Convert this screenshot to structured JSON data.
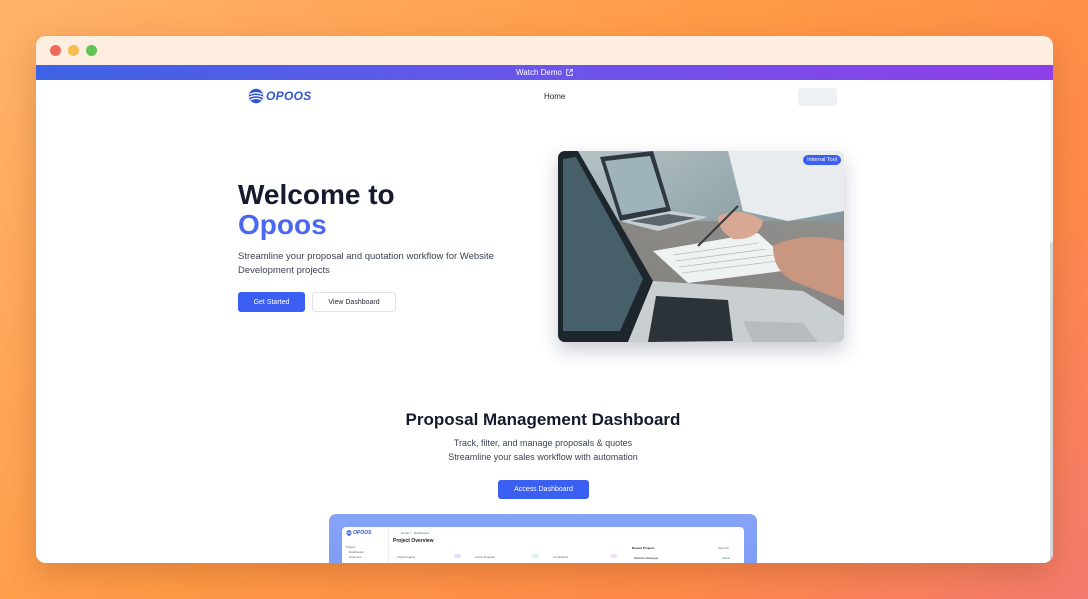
{
  "banner": {
    "text": "Watch Demo",
    "icon": "external-link-icon"
  },
  "nav": {
    "logo": "OPOOS",
    "home": "Home"
  },
  "hero": {
    "title_line1": "Welcome to",
    "title_line2": "Opoos",
    "subtitle": "Streamline your proposal and quotation workflow for Website Development projects",
    "primary_button": "Get Started",
    "secondary_button": "View Dashboard",
    "image_badge": "Internal Tool"
  },
  "dashboard_section": {
    "title": "Proposal Management Dashboard",
    "subtitle_line1": "Track, filter, and manage proposals & quotes",
    "subtitle_line2": "Streamline your sales workflow with automation",
    "button": "Access Dashboard"
  },
  "preview": {
    "logo": "OPOOS",
    "breadcrumb_home": "Home",
    "breadcrumb_sep": "/",
    "breadcrumb_page": "Dashboard",
    "title": "Project Overview",
    "sidebar_label": "Project",
    "sidebar_items": [
      "Dashboard",
      "Overview"
    ],
    "stats": [
      "Total Projects",
      "Active Projects",
      "Completed"
    ],
    "recent_title": "Recent Projects",
    "recent_action": "View All",
    "recent_row": "Website Redesign",
    "recent_status": "Active"
  },
  "colors": {
    "accent": "#3b5ff3",
    "banner_start": "#3d63e6",
    "banner_end": "#8f3ee8",
    "title_accent": "#4a68f0"
  }
}
